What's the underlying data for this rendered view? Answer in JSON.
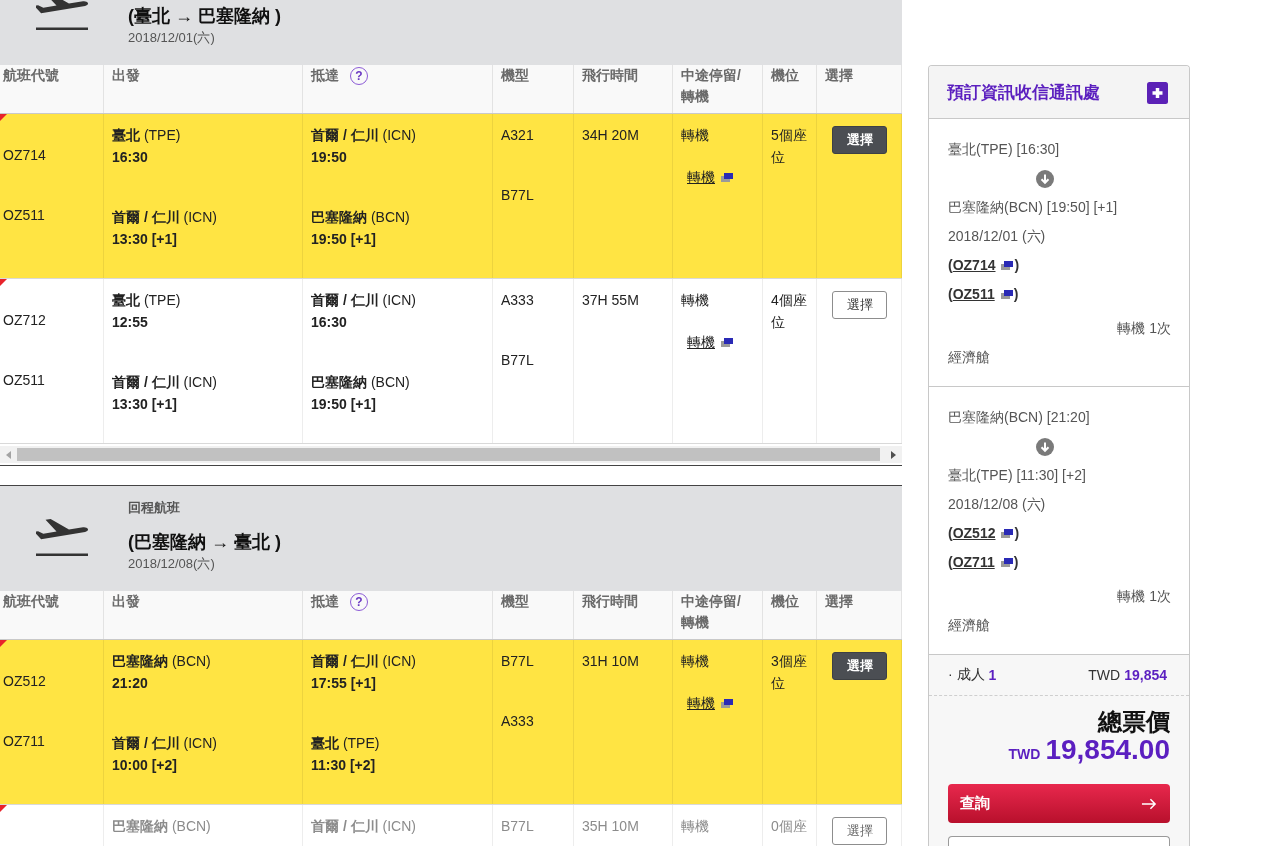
{
  "sections": [
    {
      "title": "(臺北 → 巴塞隆納 )",
      "date": "2018/12/01(六)",
      "columns": [
        {
          "label": "航班代號"
        },
        {
          "label": "出發"
        },
        {
          "label": "抵達",
          "help": "?"
        },
        {
          "label": "機型"
        },
        {
          "label": "飛行時間"
        },
        {
          "label": "中途停留/\n轉機"
        },
        {
          "label": "機位"
        },
        {
          "label": "選擇"
        }
      ],
      "rows": [
        {
          "selected": true,
          "disabled": false,
          "flights": [
            "OZ714",
            "OZ511"
          ],
          "departures": [
            {
              "airport": "**臺北** (TPE)",
              "time": "16:30"
            },
            {
              "airport": "**首爾 / 仁川** (ICN)",
              "time": "13:30 [+1]"
            }
          ],
          "arrivals": [
            {
              "airport": "**首爾 / 仁川** (ICN)",
              "time": "19:50"
            },
            {
              "airport": "**巴塞隆納** (BCN)",
              "time": "19:50 [+1]"
            }
          ],
          "aircraft": [
            "A321",
            "B77L"
          ],
          "duration": "34H 20M",
          "stop": "轉機",
          "stop_link": "轉機",
          "seats": "5個座位",
          "action": "選擇"
        },
        {
          "selected": false,
          "disabled": false,
          "flights": [
            "OZ712",
            "OZ511"
          ],
          "departures": [
            {
              "airport": "**臺北** (TPE)",
              "time": "12:55"
            },
            {
              "airport": "**首爾 / 仁川** (ICN)",
              "time": "13:30 [+1]"
            }
          ],
          "arrivals": [
            {
              "airport": "**首爾 / 仁川** (ICN)",
              "time": "16:30"
            },
            {
              "airport": "**巴塞隆納** (BCN)",
              "time": "19:50 [+1]"
            }
          ],
          "aircraft": [
            "A333",
            "B77L"
          ],
          "duration": "37H 55M",
          "stop": "轉機",
          "stop_link": "轉機",
          "seats": "4個座位",
          "action": "選擇"
        }
      ]
    },
    {
      "label": "回程航班",
      "title": "(巴塞隆納 → 臺北 )",
      "date": "2018/12/08(六)",
      "columns": [
        {
          "label": "航班代號"
        },
        {
          "label": "出發"
        },
        {
          "label": "抵達",
          "help": "?"
        },
        {
          "label": "機型"
        },
        {
          "label": "飛行時間"
        },
        {
          "label": "中途停留/\n轉機"
        },
        {
          "label": "機位"
        },
        {
          "label": "選擇"
        }
      ],
      "rows": [
        {
          "selected": true,
          "disabled": false,
          "flights": [
            "OZ512",
            "OZ711"
          ],
          "departures": [
            {
              "airport": "**巴塞隆納** (BCN)",
              "time": "21:20"
            },
            {
              "airport": "**首爾 / 仁川** (ICN)",
              "time": "10:00 [+2]"
            }
          ],
          "arrivals": [
            {
              "airport": "**首爾 / 仁川** (ICN)",
              "time": "17:55 [+1]"
            },
            {
              "airport": "**臺北** (TPE)",
              "time": "11:30 [+2]"
            }
          ],
          "aircraft": [
            "B77L",
            "A333"
          ],
          "duration": "31H 10M",
          "stop": "轉機",
          "stop_link": "轉機",
          "seats": "3個座位",
          "action": "選擇"
        },
        {
          "selected": false,
          "disabled": true,
          "departures": [
            {
              "airport": "**巴塞隆納** (BCN)"
            }
          ],
          "arrivals": [
            {
              "airport": "**首爾 / 仁川** (ICN)"
            }
          ],
          "aircraft": [
            "B77L"
          ],
          "duration": "35H 10M",
          "stop": "轉機",
          "seats": "0個座",
          "action": "選擇"
        }
      ]
    }
  ],
  "summary": {
    "title": "預訂資訊收信通訊處",
    "itineraries": [
      {
        "origin": "臺北(TPE) [16:30]",
        "destination": "巴塞隆納(BCN) [19:50] [+1]",
        "date": "2018/12/01 (六)",
        "flights": [
          {
            "prefix": "(",
            "code": "OZ714",
            "suffix": ")"
          },
          {
            "prefix": "(",
            "code": "OZ511",
            "suffix": ")"
          }
        ],
        "transfers": "轉機 1次",
        "cabin": "經濟艙"
      },
      {
        "origin": "巴塞隆納(BCN) [21:20]",
        "destination": "臺北(TPE) [11:30] [+2]",
        "date": "2018/12/08 (六)",
        "flights": [
          {
            "prefix": "(",
            "code": "OZ512",
            "suffix": ")"
          },
          {
            "prefix": "(",
            "code": "OZ711",
            "suffix": ")"
          }
        ],
        "transfers": "轉機 1次",
        "cabin": "經濟艙"
      }
    ],
    "fare": {
      "passenger": "· 成人",
      "count": "1",
      "currency": "TWD",
      "amount": "19,854"
    },
    "total": {
      "label": "總票價",
      "currency": "TWD",
      "amount": "19,854.00"
    },
    "buttons": [
      {
        "kind": "primary",
        "label": "查詢"
      },
      {
        "kind": "secondary"
      }
    ]
  }
}
